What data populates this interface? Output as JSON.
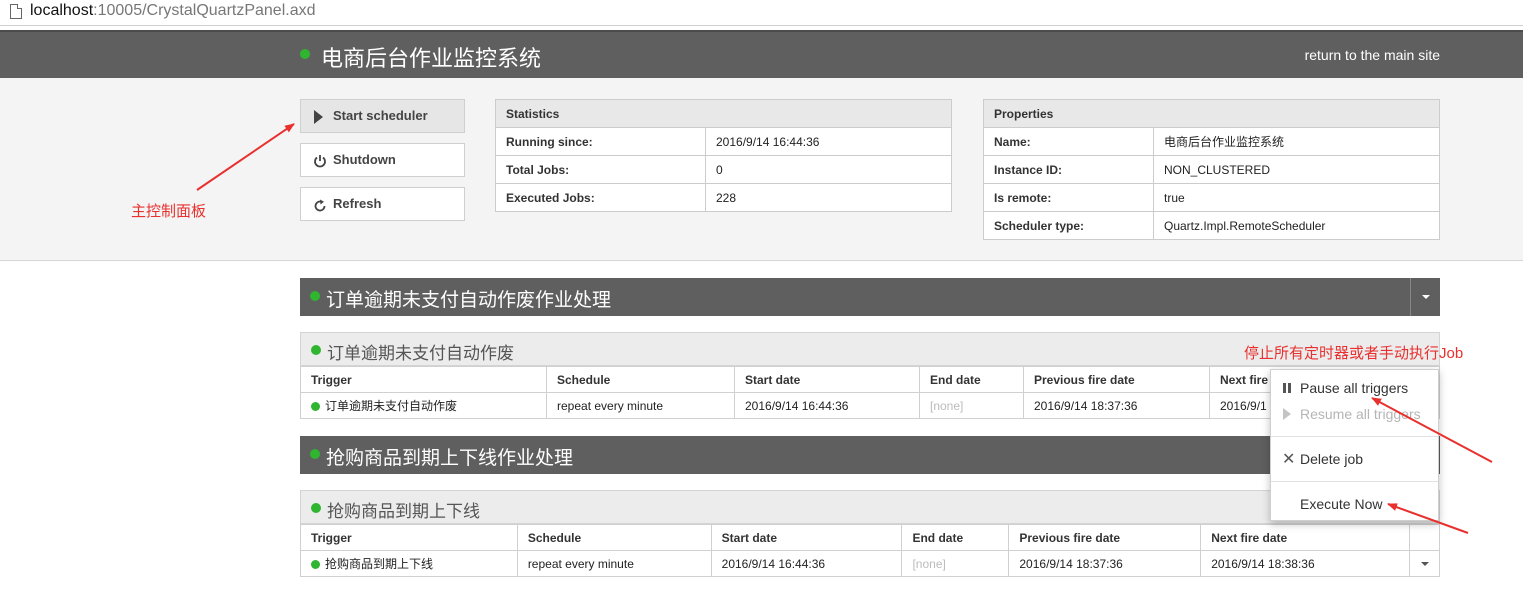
{
  "address_bar": {
    "host": "localhost",
    "path": ":10005/CrystalQuartzPanel.axd"
  },
  "header": {
    "title": "电商后台作业监控系统",
    "return_link": "return to the main site"
  },
  "controls": {
    "start_label": "Start scheduler",
    "shutdown_label": "Shutdown",
    "refresh_label": "Refresh"
  },
  "statistics": {
    "title": "Statistics",
    "rows": [
      {
        "key": "Running since:",
        "value": "2016/9/14 16:44:36"
      },
      {
        "key": "Total Jobs:",
        "value": "0"
      },
      {
        "key": "Executed Jobs:",
        "value": "228"
      }
    ]
  },
  "properties": {
    "title": "Properties",
    "rows": [
      {
        "key": "Name:",
        "value": "电商后台作业监控系统"
      },
      {
        "key": "Instance ID:",
        "value": "NON_CLUSTERED"
      },
      {
        "key": "Is remote:",
        "value": "true"
      },
      {
        "key": "Scheduler type:",
        "value": "Quartz.Impl.RemoteScheduler"
      }
    ]
  },
  "annotations": {
    "main_panel": "主控制面板",
    "menu_note": "停止所有定时器或者手动执行Job"
  },
  "trigger_columns": [
    "Trigger",
    "Schedule",
    "Start date",
    "End date",
    "Previous fire date",
    "Next fire date"
  ],
  "groups": [
    {
      "title": "订单逾期未支付自动作废作业处理",
      "job": {
        "title": "订单逾期未支付自动作废",
        "next_fire_header_truncated": "Next fire",
        "trigger": {
          "name": "订单逾期未支付自动作废",
          "schedule": "repeat every minute",
          "start": "2016/9/14 16:44:36",
          "end": "[none]",
          "previous": "2016/9/14 18:37:36",
          "next_truncated": "2016/9/1"
        }
      }
    },
    {
      "title": "抢购商品到期上下线作业处理",
      "job": {
        "title": "抢购商品到期上下线",
        "trigger": {
          "name": "抢购商品到期上下线",
          "schedule": "repeat every minute",
          "start": "2016/9/14 16:44:36",
          "end": "[none]",
          "previous": "2016/9/14 18:37:36",
          "next": "2016/9/14 18:38:36"
        }
      }
    }
  ],
  "menu": {
    "pause_all": "Pause all triggers",
    "resume_all": "Resume all triggers",
    "delete_job": "Delete job",
    "execute_now": "Execute Now"
  },
  "colors": {
    "header_bg": "#5f5f5f",
    "status_green": "#2fb52f",
    "annotation_red": "#e8302e"
  }
}
